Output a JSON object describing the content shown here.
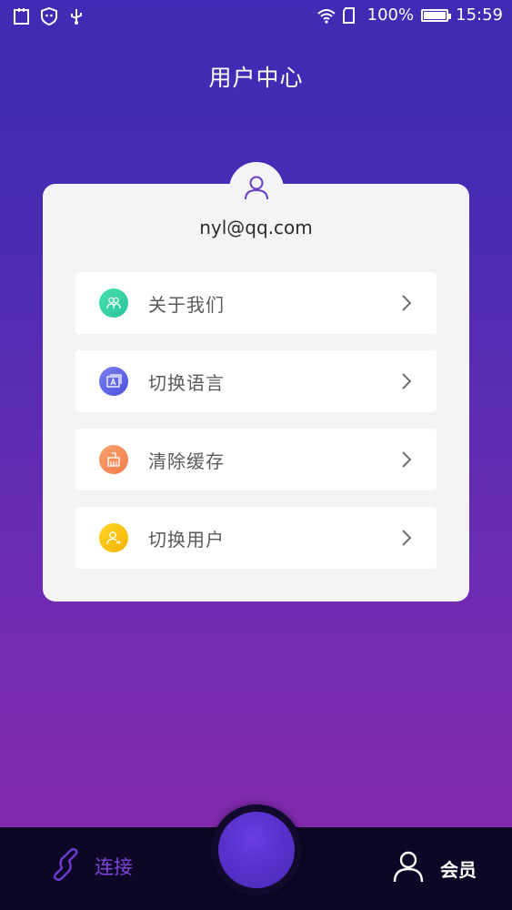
{
  "status_bar": {
    "battery_text": "100%",
    "time": "15:59",
    "left_icons": [
      "calendar-icon",
      "shield-icon",
      "usb-icon"
    ],
    "right_icons": [
      "wifi-icon",
      "sim-icon",
      "battery-icon"
    ]
  },
  "header": {
    "title": "用户中心"
  },
  "profile": {
    "email": "nyl@qq.com",
    "avatar_icon": "user-icon"
  },
  "menu": {
    "items": [
      {
        "label": "关于我们",
        "icon": "users-icon",
        "color": "#36d2a4"
      },
      {
        "label": "切换语言",
        "icon": "language-icon",
        "color": "#5b63e6"
      },
      {
        "label": "清除缓存",
        "icon": "broom-icon",
        "color": "#f7905e"
      },
      {
        "label": "切换用户",
        "icon": "user-switch-icon",
        "color": "#f7c31a"
      }
    ]
  },
  "bottom_nav": {
    "connect_label": "连接",
    "member_label": "会员",
    "connect_color": "#7e45d6",
    "center_button_color": "#5a32cf"
  }
}
